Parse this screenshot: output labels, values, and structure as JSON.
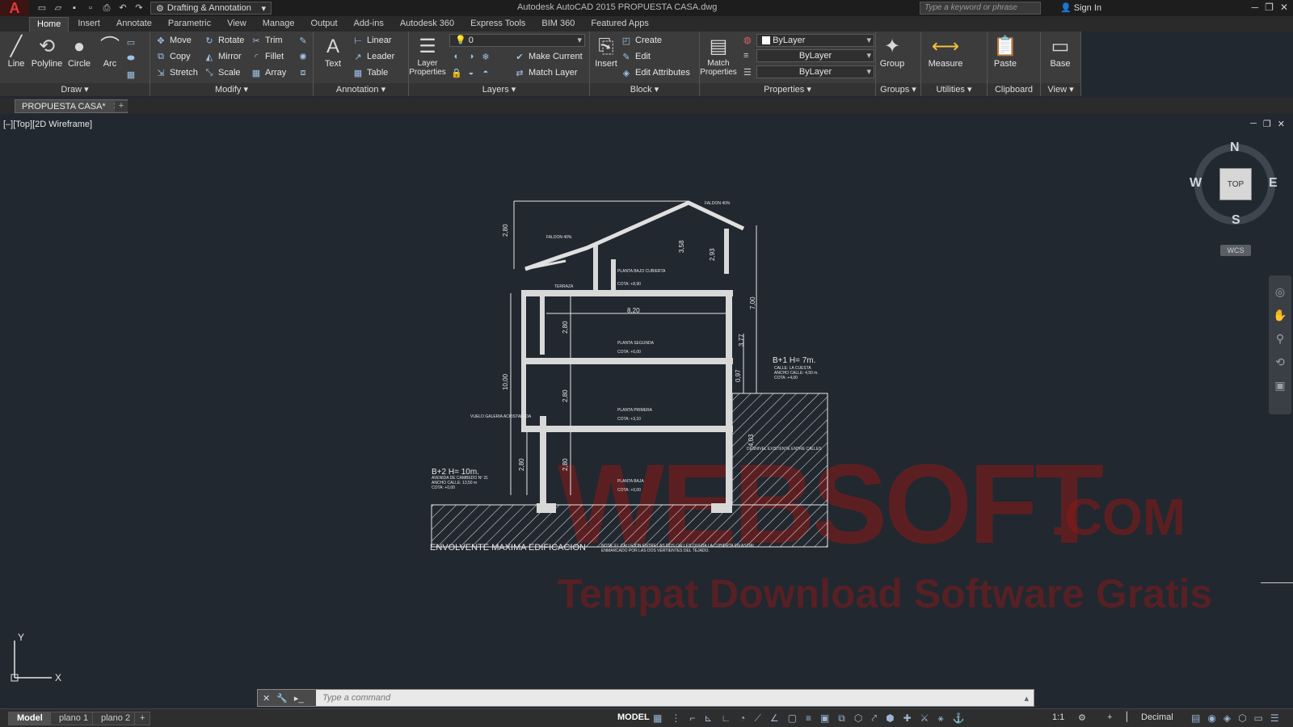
{
  "titlebar": {
    "logo": "A",
    "workspace": "Drafting & Annotation",
    "title": "Autodesk AutoCAD 2015   PROPUESTA CASA.dwg",
    "search_placeholder": "Type a keyword or phrase",
    "sign_in": "Sign In"
  },
  "ribbon_tabs": [
    "Home",
    "Insert",
    "Annotate",
    "Parametric",
    "View",
    "Manage",
    "Output",
    "Add-ins",
    "Autodesk 360",
    "Express Tools",
    "BIM 360",
    "Featured Apps"
  ],
  "panels": {
    "draw": {
      "title": "Draw",
      "line": "Line",
      "polyline": "Polyline",
      "circle": "Circle",
      "arc": "Arc"
    },
    "modify": {
      "title": "Modify",
      "move": "Move",
      "rotate": "Rotate",
      "trim": "Trim",
      "copy": "Copy",
      "mirror": "Mirror",
      "fillet": "Fillet",
      "stretch": "Stretch",
      "scale": "Scale",
      "array": "Array"
    },
    "annotation": {
      "title": "Annotation",
      "text": "Text",
      "linear": "Linear",
      "leader": "Leader",
      "table": "Table"
    },
    "layers": {
      "title": "Layers",
      "layer_properties": "Layer Properties",
      "current_layer": "0",
      "make_current": "Make Current",
      "match_layer": "Match Layer"
    },
    "block": {
      "title": "Block",
      "insert": "Insert",
      "create": "Create",
      "edit": "Edit",
      "edit_attributes": "Edit Attributes"
    },
    "properties": {
      "title": "Properties",
      "match_properties": "Match Properties",
      "color": "ByLayer",
      "linetype": "ByLayer",
      "lineweight": "ByLayer"
    },
    "groups": {
      "title": "Groups",
      "group": "Group"
    },
    "utilities": {
      "title": "Utilities",
      "measure": "Measure"
    },
    "clipboard": {
      "title": "Clipboard",
      "paste": "Paste"
    },
    "view": {
      "title": "View",
      "base": "Base"
    }
  },
  "file_tab": "PROPUESTA CASA*",
  "viewport": {
    "label": "[–][Top][2D Wireframe]",
    "viewcube": {
      "top": "TOP",
      "n": "N",
      "s": "S",
      "e": "E",
      "w": "W",
      "wcs": "WCS"
    },
    "ucs_x": "X",
    "ucs_y": "Y"
  },
  "drawing": {
    "labels": {
      "faldon_left": "FALDON 40%",
      "faldon_right": "FALDON 40%",
      "terraza": "TERRAZA",
      "bajo_cubierta": "PLANTA BAJO CUBIERTA",
      "cota_bc": "COTA: +8,90",
      "segunda": "PLANTA SEGUNDA",
      "cota_2": "COTA: +6,00",
      "primera": "PLANTA PRIMERA",
      "cota_1": "COTA: +3,10",
      "baja": "PLANTA BAJA",
      "cota_0": "COTA: +0,00",
      "vuelo": "VUELO GALERIA ACRISTALADA",
      "desnivel": "DESNIVEL EXISTENTE ENTRE CALLES",
      "b1_title": "B+1 H= 7m.",
      "b1_l1": "CALLE: LA CUESTA",
      "b1_l2": "ANCHO CALLE: 4,50 m.",
      "b1_l3": "COTA: +4,00",
      "b2_title": "B+2 H= 10m.",
      "b2_l1": "AVENIDA DE CAMBEDO Nº 31",
      "b2_l2": "ANCHO CALLE: 13,50 m",
      "b2_l3": "COTA: +0,00",
      "envolvente": "ENVOLVENTE MAXIMA EDIFICACION",
      "nota_1": "NOTA: EL CALLEJON ENTRE LAS DOS CALLES QUEDA LA CUBIERTA EN ASTIAL",
      "nota_2": "ENMARCADO POR LAS DOS VERTIENTES DEL TEJADO."
    },
    "dims": [
      "2,80",
      "3,58",
      "2,93",
      "8,20",
      "7,00",
      "2,80",
      "3,77",
      "0,97",
      "10,00",
      "2,80",
      "2,80",
      "2,80",
      "4,03"
    ]
  },
  "watermark": {
    "main": "WEBSOFT",
    "com": ".COM",
    "sub": "Tempat Download Software Gratis"
  },
  "command": {
    "placeholder": "Type a command"
  },
  "layout_tabs": [
    "Model",
    "plano 1",
    "plano 2"
  ],
  "status": {
    "model": "MODEL",
    "scale": "1:1",
    "units": "Decimal"
  },
  "colors": {
    "ribbon_bg": "#3c3c3c",
    "viewport_bg": "#212830",
    "accent": "#e43b3b",
    "hatch": "#e8e8e8"
  }
}
